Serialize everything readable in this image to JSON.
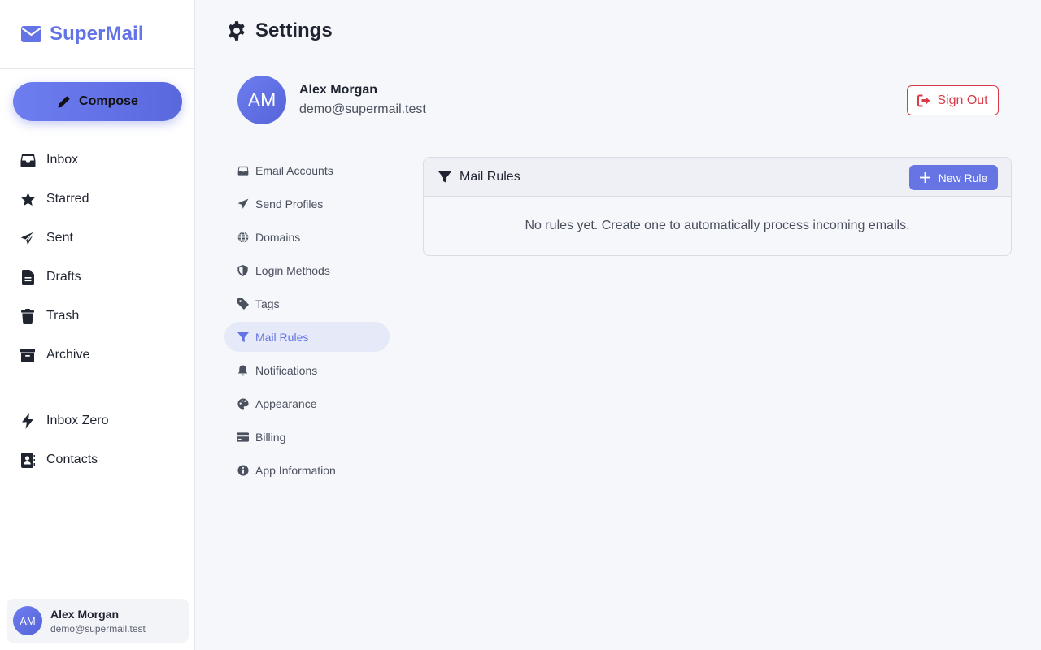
{
  "app": {
    "name": "SuperMail",
    "icon": "envelope-icon"
  },
  "compose": {
    "label": "Compose",
    "icon": "pencil-icon"
  },
  "nav": {
    "items": [
      {
        "label": "Inbox",
        "icon": "inbox-icon"
      },
      {
        "label": "Starred",
        "icon": "star-icon"
      },
      {
        "label": "Sent",
        "icon": "paper-plane-icon"
      },
      {
        "label": "Drafts",
        "icon": "file-icon"
      },
      {
        "label": "Trash",
        "icon": "trash-icon"
      },
      {
        "label": "Archive",
        "icon": "archive-icon"
      }
    ],
    "secondary": [
      {
        "label": "Inbox Zero",
        "icon": "bolt-icon"
      },
      {
        "label": "Contacts",
        "icon": "address-book-icon"
      }
    ]
  },
  "user": {
    "name": "Alex Morgan",
    "email": "demo@supermail.test",
    "initials": "AM"
  },
  "page": {
    "title": "Settings",
    "icon": "gear-icon"
  },
  "signout": {
    "label": "Sign Out",
    "icon": "sign-out-icon"
  },
  "settings_nav": {
    "active": "Mail Rules",
    "items": [
      {
        "label": "Email Accounts",
        "icon": "inbox-icon"
      },
      {
        "label": "Send Profiles",
        "icon": "paper-plane-icon"
      },
      {
        "label": "Domains",
        "icon": "globe-icon"
      },
      {
        "label": "Login Methods",
        "icon": "shield-icon"
      },
      {
        "label": "Tags",
        "icon": "tag-icon"
      },
      {
        "label": "Mail Rules",
        "icon": "filter-icon"
      },
      {
        "label": "Notifications",
        "icon": "bell-icon"
      },
      {
        "label": "Appearance",
        "icon": "palette-icon"
      },
      {
        "label": "Billing",
        "icon": "credit-card-icon"
      },
      {
        "label": "App Information",
        "icon": "info-icon"
      }
    ]
  },
  "mail_rules": {
    "title": "Mail Rules",
    "icon": "filter-icon",
    "new_rule_label": "New Rule",
    "empty_message": "No rules yet. Create one to automatically process incoming emails."
  },
  "colors": {
    "accent": "#6474e6",
    "danger": "#d93b48",
    "background": "#f6f7fb",
    "active_bg": "#e6e9f8"
  }
}
